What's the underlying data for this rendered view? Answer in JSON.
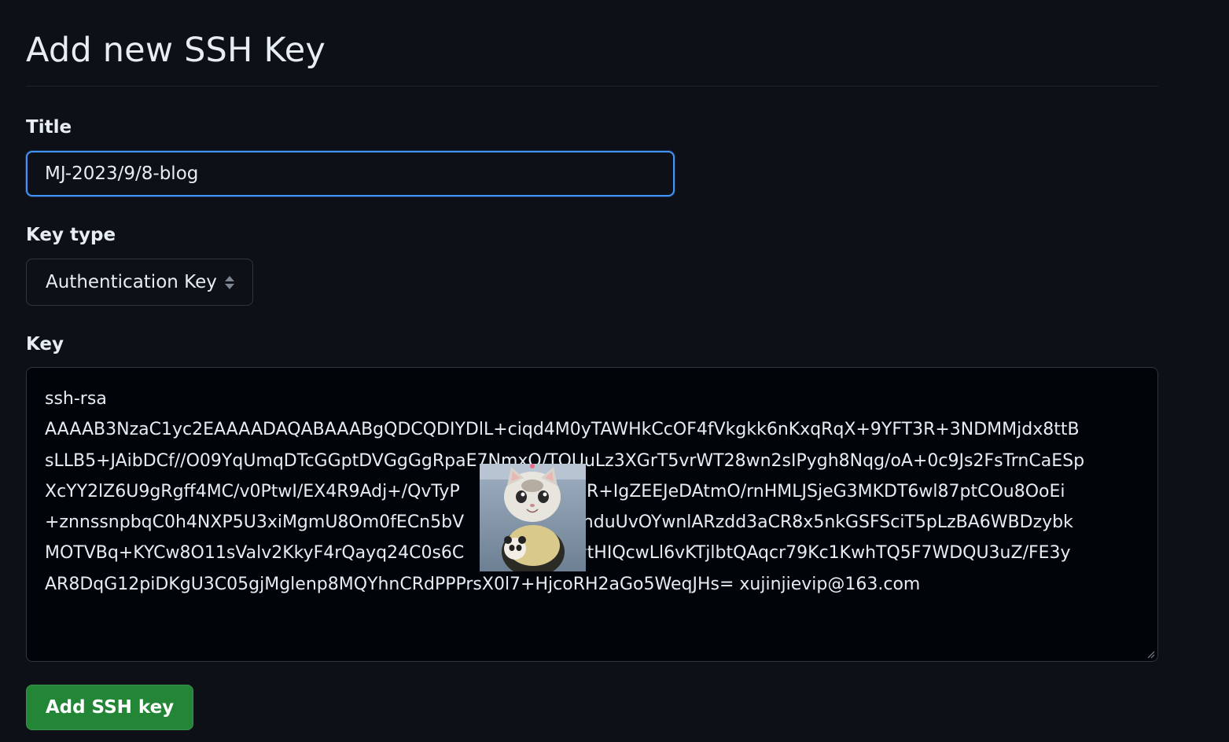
{
  "page": {
    "title": "Add new SSH Key"
  },
  "form": {
    "title_label": "Title",
    "title_value": "MJ-2023/9/8-blog",
    "key_type_label": "Key type",
    "key_type_value": "Authentication Key",
    "key_label": "Key",
    "key_value": "ssh-rsa\nAAAAB3NzaC1yc2EAAAADAQABAAABgQDCQDIYDlL+ciqd4M0yTAWHkCcOF4fVkgkk6nKxqRqX+9YFT3R+3NDMMjdx8ttB\nsLLB5+JAibDCf//O09YqUmqDTcGGptDVGgGgRpaE7NmxO/TOUuLz3XGrT5vrWT28wn2sIPygh8Nqg/oA+0c9Js2FsTrnCaESp\nXcYY2lZ6U9gRgff4MC/v0PtwI/EX4R9Adj+/QvTyP              WyBnR+IgZEEJeDAtmO/rnHMLJSjeG3MKDT6wl87ptCOu8OoEi\n+znnssnpbqC0h4NXP5U3xiMgmU8Om0fECn5bV              3LvanduUvOYwnlARzdd3aCR8x5nkGSFSciT5pLzBA6WBDzybk\nMOTVBq+KYCw8O11sValv2KkyF4rQayq24C0s6C              7v+vtHIQcwLl6vKTjlbtQAqcr79Kc1KwhTQ5F7WDQU3uZ/FE3y\nAR8DqG12piDKgU3C05gjMglenp8MQYhnCRdPPPrsX0l7+HjcoRH2aGo5WeqJHs= xujinjievip@163.com",
    "submit_label": "Add SSH key"
  },
  "colors": {
    "background": "#0d1117",
    "focus_border": "#4493f8",
    "button_green": "#238636",
    "textarea_bg": "#010409"
  },
  "icons": {
    "select_arrows": "chevron-up-down-icon",
    "resize": "resize-grip-icon"
  }
}
